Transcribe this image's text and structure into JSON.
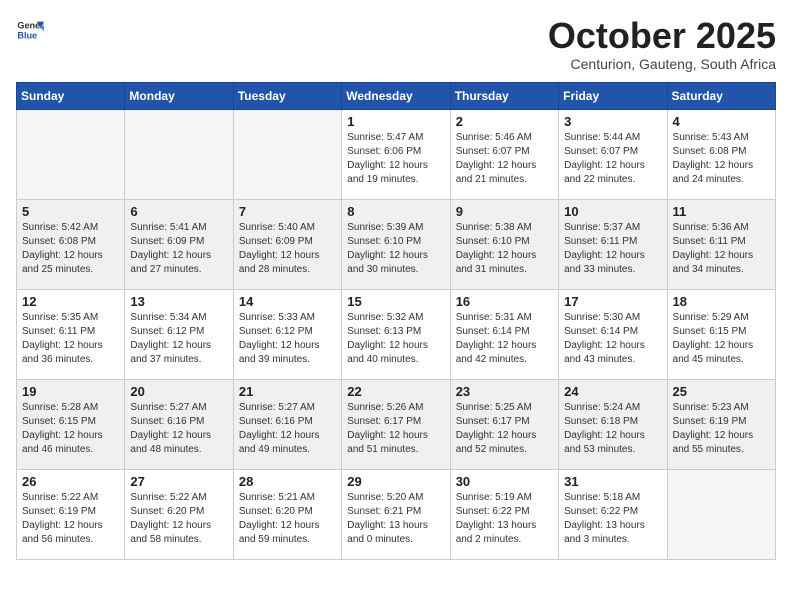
{
  "header": {
    "logo_general": "General",
    "logo_blue": "Blue",
    "month": "October 2025",
    "location": "Centurion, Gauteng, South Africa"
  },
  "days_of_week": [
    "Sunday",
    "Monday",
    "Tuesday",
    "Wednesday",
    "Thursday",
    "Friday",
    "Saturday"
  ],
  "weeks": [
    [
      {
        "day": "",
        "info": ""
      },
      {
        "day": "",
        "info": ""
      },
      {
        "day": "",
        "info": ""
      },
      {
        "day": "1",
        "info": "Sunrise: 5:47 AM\nSunset: 6:06 PM\nDaylight: 12 hours\nand 19 minutes."
      },
      {
        "day": "2",
        "info": "Sunrise: 5:46 AM\nSunset: 6:07 PM\nDaylight: 12 hours\nand 21 minutes."
      },
      {
        "day": "3",
        "info": "Sunrise: 5:44 AM\nSunset: 6:07 PM\nDaylight: 12 hours\nand 22 minutes."
      },
      {
        "day": "4",
        "info": "Sunrise: 5:43 AM\nSunset: 6:08 PM\nDaylight: 12 hours\nand 24 minutes."
      }
    ],
    [
      {
        "day": "5",
        "info": "Sunrise: 5:42 AM\nSunset: 6:08 PM\nDaylight: 12 hours\nand 25 minutes."
      },
      {
        "day": "6",
        "info": "Sunrise: 5:41 AM\nSunset: 6:09 PM\nDaylight: 12 hours\nand 27 minutes."
      },
      {
        "day": "7",
        "info": "Sunrise: 5:40 AM\nSunset: 6:09 PM\nDaylight: 12 hours\nand 28 minutes."
      },
      {
        "day": "8",
        "info": "Sunrise: 5:39 AM\nSunset: 6:10 PM\nDaylight: 12 hours\nand 30 minutes."
      },
      {
        "day": "9",
        "info": "Sunrise: 5:38 AM\nSunset: 6:10 PM\nDaylight: 12 hours\nand 31 minutes."
      },
      {
        "day": "10",
        "info": "Sunrise: 5:37 AM\nSunset: 6:11 PM\nDaylight: 12 hours\nand 33 minutes."
      },
      {
        "day": "11",
        "info": "Sunrise: 5:36 AM\nSunset: 6:11 PM\nDaylight: 12 hours\nand 34 minutes."
      }
    ],
    [
      {
        "day": "12",
        "info": "Sunrise: 5:35 AM\nSunset: 6:11 PM\nDaylight: 12 hours\nand 36 minutes."
      },
      {
        "day": "13",
        "info": "Sunrise: 5:34 AM\nSunset: 6:12 PM\nDaylight: 12 hours\nand 37 minutes."
      },
      {
        "day": "14",
        "info": "Sunrise: 5:33 AM\nSunset: 6:12 PM\nDaylight: 12 hours\nand 39 minutes."
      },
      {
        "day": "15",
        "info": "Sunrise: 5:32 AM\nSunset: 6:13 PM\nDaylight: 12 hours\nand 40 minutes."
      },
      {
        "day": "16",
        "info": "Sunrise: 5:31 AM\nSunset: 6:14 PM\nDaylight: 12 hours\nand 42 minutes."
      },
      {
        "day": "17",
        "info": "Sunrise: 5:30 AM\nSunset: 6:14 PM\nDaylight: 12 hours\nand 43 minutes."
      },
      {
        "day": "18",
        "info": "Sunrise: 5:29 AM\nSunset: 6:15 PM\nDaylight: 12 hours\nand 45 minutes."
      }
    ],
    [
      {
        "day": "19",
        "info": "Sunrise: 5:28 AM\nSunset: 6:15 PM\nDaylight: 12 hours\nand 46 minutes."
      },
      {
        "day": "20",
        "info": "Sunrise: 5:27 AM\nSunset: 6:16 PM\nDaylight: 12 hours\nand 48 minutes."
      },
      {
        "day": "21",
        "info": "Sunrise: 5:27 AM\nSunset: 6:16 PM\nDaylight: 12 hours\nand 49 minutes."
      },
      {
        "day": "22",
        "info": "Sunrise: 5:26 AM\nSunset: 6:17 PM\nDaylight: 12 hours\nand 51 minutes."
      },
      {
        "day": "23",
        "info": "Sunrise: 5:25 AM\nSunset: 6:17 PM\nDaylight: 12 hours\nand 52 minutes."
      },
      {
        "day": "24",
        "info": "Sunrise: 5:24 AM\nSunset: 6:18 PM\nDaylight: 12 hours\nand 53 minutes."
      },
      {
        "day": "25",
        "info": "Sunrise: 5:23 AM\nSunset: 6:19 PM\nDaylight: 12 hours\nand 55 minutes."
      }
    ],
    [
      {
        "day": "26",
        "info": "Sunrise: 5:22 AM\nSunset: 6:19 PM\nDaylight: 12 hours\nand 56 minutes."
      },
      {
        "day": "27",
        "info": "Sunrise: 5:22 AM\nSunset: 6:20 PM\nDaylight: 12 hours\nand 58 minutes."
      },
      {
        "day": "28",
        "info": "Sunrise: 5:21 AM\nSunset: 6:20 PM\nDaylight: 12 hours\nand 59 minutes."
      },
      {
        "day": "29",
        "info": "Sunrise: 5:20 AM\nSunset: 6:21 PM\nDaylight: 13 hours\nand 0 minutes."
      },
      {
        "day": "30",
        "info": "Sunrise: 5:19 AM\nSunset: 6:22 PM\nDaylight: 13 hours\nand 2 minutes."
      },
      {
        "day": "31",
        "info": "Sunrise: 5:18 AM\nSunset: 6:22 PM\nDaylight: 13 hours\nand 3 minutes."
      },
      {
        "day": "",
        "info": ""
      }
    ]
  ]
}
